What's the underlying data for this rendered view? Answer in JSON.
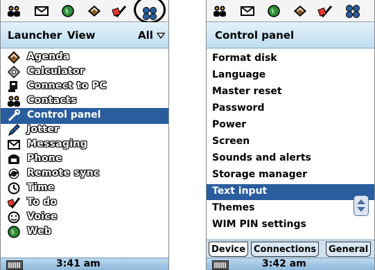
{
  "launcher": {
    "titlebar": {
      "left": "Launcher",
      "middle": "View",
      "right": "All"
    },
    "icons": [
      "contacts-icon",
      "messaging-icon",
      "web-icon",
      "agenda-icon",
      "todo-icon",
      "launcher-icon"
    ],
    "items": [
      {
        "label": "Agenda",
        "icon": "agenda-icon"
      },
      {
        "label": "Calculator",
        "icon": "calculator-icon"
      },
      {
        "label": "Connect to PC",
        "icon": "connect-pc-icon"
      },
      {
        "label": "Contacts",
        "icon": "contacts-icon"
      },
      {
        "label": "Control panel",
        "icon": "control-panel-icon",
        "selected": true
      },
      {
        "label": "Jotter",
        "icon": "jotter-icon"
      },
      {
        "label": "Messaging",
        "icon": "messaging-icon"
      },
      {
        "label": "Phone",
        "icon": "phone-icon"
      },
      {
        "label": "Remote sync",
        "icon": "remote-sync-icon"
      },
      {
        "label": "Time",
        "icon": "time-icon"
      },
      {
        "label": "To do",
        "icon": "todo-icon"
      },
      {
        "label": "Voice",
        "icon": "voice-icon"
      },
      {
        "label": "Web",
        "icon": "web-icon"
      }
    ],
    "status": {
      "time": "3:41 am"
    }
  },
  "control": {
    "titlebar": {
      "title": "Control panel"
    },
    "items": [
      {
        "label": "Format disk"
      },
      {
        "label": "Language"
      },
      {
        "label": "Master reset"
      },
      {
        "label": "Password"
      },
      {
        "label": "Power"
      },
      {
        "label": "Screen"
      },
      {
        "label": "Sounds and alerts"
      },
      {
        "label": "Storage manager"
      },
      {
        "label": "Text input",
        "selected": true
      },
      {
        "label": "Themes"
      },
      {
        "label": "WIM PIN settings"
      }
    ],
    "tabs": [
      {
        "label": "Device",
        "active": true
      },
      {
        "label": "Connections"
      },
      {
        "label": "General"
      }
    ],
    "status": {
      "time": "3:42 am"
    }
  },
  "colors": {
    "selection": "#2a5d9d",
    "titlebar": "#cfe4f4",
    "statusbar": "#a9cae4"
  }
}
